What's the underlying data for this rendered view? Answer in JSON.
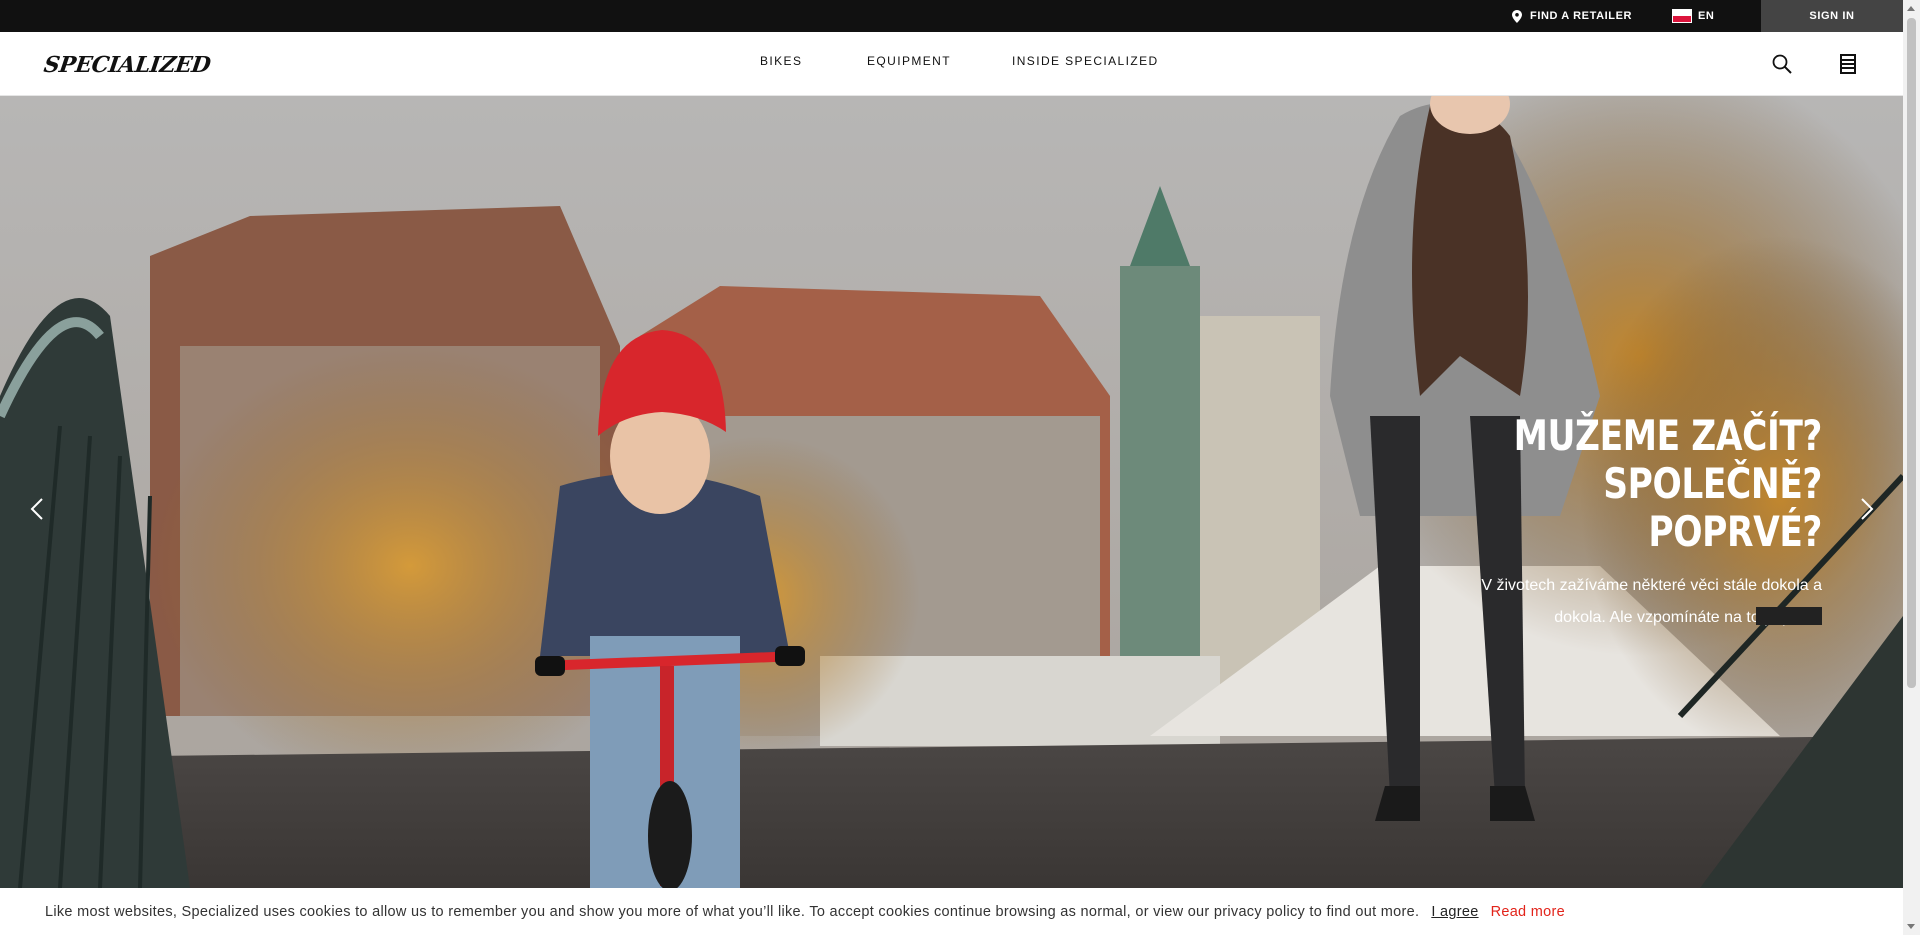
{
  "topbar": {
    "retailer_label": "FIND A RETAILER",
    "retailer_icon": "map-pin-icon",
    "language_label": "EN",
    "language_flag": "flag-icon",
    "signin_label": "SIGN IN"
  },
  "header": {
    "logo_text": "SPECIALIZED",
    "nav": [
      {
        "label": "BIKES"
      },
      {
        "label": "EQUIPMENT"
      },
      {
        "label": "INSIDE SPECIALIZED"
      }
    ],
    "search_icon": "search-icon",
    "list_icon": "list-icon"
  },
  "hero": {
    "title_line1": "MUŽEME ZAČÍT?",
    "title_line2": "SPOLEČNĚ? POPRVÉ?",
    "subtitle_line1": "V životech zažíváme některé věci stále dokola a",
    "subtitle_line2": "dokola. Ale vzpomínáte na to poprvé?",
    "prev_icon": "chevron-left-icon",
    "next_icon": "chevron-right-icon"
  },
  "cookie": {
    "message": "Like most websites, Specialized uses cookies to allow us to remember you and show you more of what you’ll like. To accept cookies continue browsing as normal, or view our privacy policy to find out more.",
    "agree_label": "I agree",
    "more_label": "Read more"
  },
  "colors": {
    "topbar_bg": "#111111",
    "signin_bg": "#444444",
    "accent_red": "#e2231a",
    "helmet_red": "#d8262c"
  }
}
